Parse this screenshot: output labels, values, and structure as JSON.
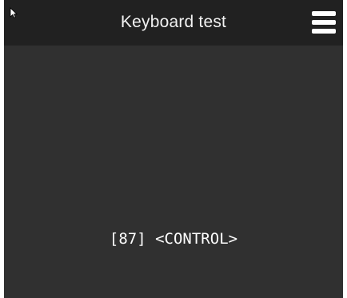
{
  "window": {
    "title": "Keyboard test"
  },
  "toolbar": {
    "menu_icon": "hamburger-menu-icon",
    "pointer_icon": "mouse-pointer-icon"
  },
  "main": {
    "key_event_text": "[87] <CONTROL>"
  },
  "colors": {
    "appbar_background": "#212121",
    "content_background": "#303030",
    "text": "#ffffff"
  }
}
